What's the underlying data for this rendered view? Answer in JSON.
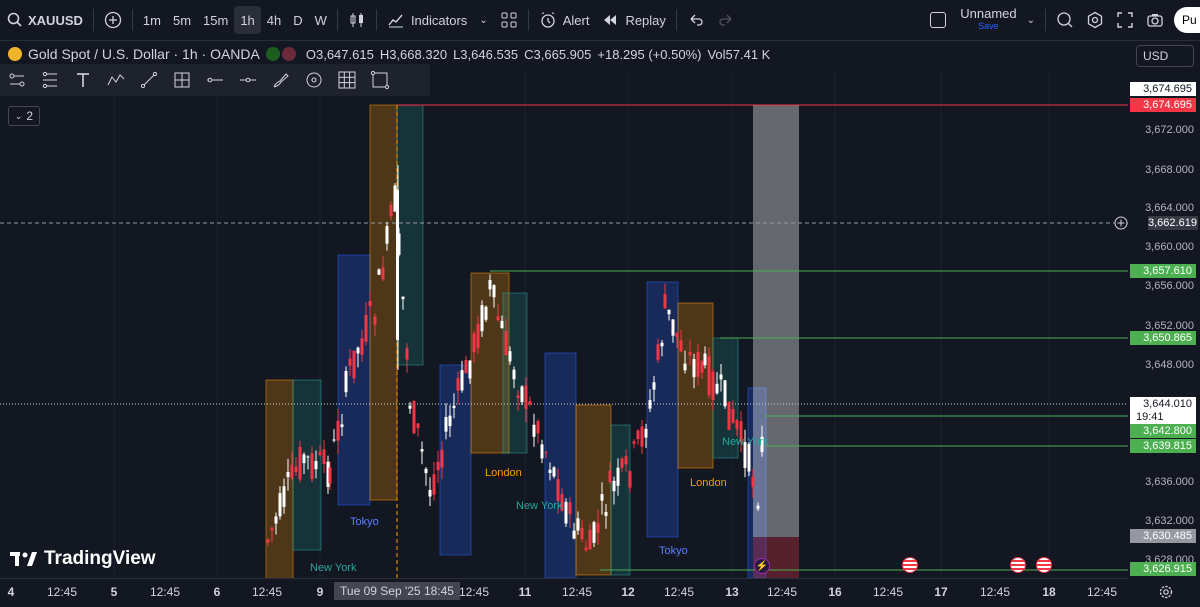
{
  "toolbar": {
    "symbol": "XAUUSD",
    "intervals": [
      "1m",
      "5m",
      "15m",
      "1h",
      "4h",
      "D",
      "W"
    ],
    "active_interval": "1h",
    "indicators_label": "Indicators",
    "alert_label": "Alert",
    "replay_label": "Replay",
    "layout_name": "Unnamed",
    "layout_sub": "Save",
    "publish_label": "Pu"
  },
  "legend": {
    "title": "Gold Spot / U.S. Dollar · 1h · OANDA",
    "o_key": "O",
    "o_val": "3,647.615",
    "h_key": "H",
    "h_val": "3,668.320",
    "l_key": "L",
    "l_val": "3,646.535",
    "c_key": "C",
    "c_val": "3,665.905",
    "change": "+18.295 (+0.50%)",
    "vol_key": "Vol",
    "vol_val": "57.41 K"
  },
  "currency": "USD",
  "collapse_count": "2",
  "price_axis": {
    "ticks": [
      "3,672.000",
      "3,668.000",
      "3,664.000",
      "3,660.000",
      "3,656.000",
      "3,652.000",
      "3,648.000",
      "3,636.000",
      "3,632.000",
      "3,628.000"
    ],
    "tags": [
      {
        "text": "3,674.695",
        "bg": "#ffffff",
        "fg": "#131722"
      },
      {
        "text": "3,674.695",
        "bg": "#f23645",
        "fg": "#ffffff"
      },
      {
        "text": "3,662.619",
        "bg": "#363a45",
        "fg": "#ffffff"
      },
      {
        "text": "3,657.610",
        "bg": "#4caf50",
        "fg": "#ffffff"
      },
      {
        "text": "3,650.865",
        "bg": "#4caf50",
        "fg": "#ffffff"
      },
      {
        "text": "3,644.010",
        "bg": "#ffffff",
        "fg": "#131722"
      },
      {
        "text": "19:41",
        "bg": "#ffffff",
        "fg": "#131722"
      },
      {
        "text": "3,642.800",
        "bg": "#4caf50",
        "fg": "#ffffff"
      },
      {
        "text": "3,639.815",
        "bg": "#4caf50",
        "fg": "#ffffff"
      },
      {
        "text": "3,630.485",
        "bg": "#9598a1",
        "fg": "#ffffff"
      },
      {
        "text": "3,626.915",
        "bg": "#4caf50",
        "fg": "#ffffff"
      }
    ]
  },
  "time_axis": {
    "labels": [
      {
        "text": "4",
        "day": true
      },
      {
        "text": "12:45"
      },
      {
        "text": "5",
        "day": true
      },
      {
        "text": "12:45"
      },
      {
        "text": "6",
        "day": true
      },
      {
        "text": "12:45"
      },
      {
        "text": "9",
        "day": true
      },
      {
        "text": "Tue 09 Sep '25   18:45",
        "highlight": true
      },
      {
        "text": "12:45"
      },
      {
        "text": "11",
        "day": true
      },
      {
        "text": "12:45"
      },
      {
        "text": "12",
        "day": true
      },
      {
        "text": "12:45"
      },
      {
        "text": "13",
        "day": true
      },
      {
        "text": "12:45"
      },
      {
        "text": "16",
        "day": true
      },
      {
        "text": "12:45"
      },
      {
        "text": "17",
        "day": true
      },
      {
        "text": "12:45"
      },
      {
        "text": "18",
        "day": true
      },
      {
        "text": "12:45"
      }
    ]
  },
  "sessions": [
    {
      "text": "New York",
      "color": "#26a69a"
    },
    {
      "text": "Tokyo",
      "color": "#5b7fff"
    },
    {
      "text": "London",
      "color": "#ff9800"
    },
    {
      "text": "New York",
      "color": "#26a69a"
    },
    {
      "text": "Tokyo",
      "color": "#5b7fff"
    },
    {
      "text": "London",
      "color": "#ff9800"
    },
    {
      "text": "New York",
      "color": "#26a69a"
    }
  ],
  "watermark": "TradingView",
  "colors": {
    "bg": "#131722",
    "up": "#ffffff",
    "down": "#f23645",
    "level_green": "#4caf50",
    "level_red": "#f23645",
    "tokyo_box": "#2962ff",
    "london_box": "#ff9800",
    "ny_box": "#26a69a"
  },
  "icons": [
    "search-icon",
    "plus-icon",
    "candles-icon",
    "indicators-icon",
    "templates-icon",
    "alert-icon",
    "replay-icon",
    "undo-icon",
    "redo-icon",
    "fullscreen-icon",
    "settings-icon",
    "camera-icon",
    "gear-icon"
  ]
}
